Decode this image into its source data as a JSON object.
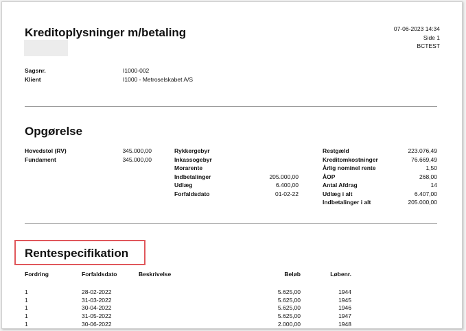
{
  "header": {
    "title": "Kreditoplysninger m/betaling",
    "date_time": "07-06-2023 14:34",
    "page": "Side 1",
    "company": "BCTEST"
  },
  "case": {
    "sagsnr_label": "Sagsnr.",
    "sagsnr_value": "I1000-002",
    "klient_label": "Klient",
    "klient_value": "I1000 - Metroselskabet A/S"
  },
  "opgorelse": {
    "heading": "Opgørelse",
    "col1": [
      {
        "label": "Hovedstol (RV)",
        "value": "345.000,00"
      },
      {
        "label": "Fundament",
        "value": "345.000,00"
      }
    ],
    "col2": [
      {
        "label": "Rykkergebyr",
        "value": ""
      },
      {
        "label": "Inkassogebyr",
        "value": ""
      },
      {
        "label": "Morarente",
        "value": ""
      },
      {
        "label": "Indbetalinger",
        "value": "205.000,00"
      },
      {
        "label": "Udlæg",
        "value": "6.400,00"
      },
      {
        "label": "Forfaldsdato",
        "value": "01-02-22"
      }
    ],
    "col3": [
      {
        "label": "Restgæld",
        "value": "223.076,49"
      },
      {
        "label": "Kreditomkostninger",
        "value": "76.669,49"
      },
      {
        "label": "Årlig nominel rente",
        "value": "1,50"
      },
      {
        "label": "ÅOP",
        "value": "268,00"
      },
      {
        "label": "Antal Afdrag",
        "value": "14"
      },
      {
        "label": "Udlæg i alt",
        "value": "6.407,00"
      },
      {
        "label": "Indbetalinger i alt",
        "value": "205.000,00"
      }
    ]
  },
  "rentespec": {
    "heading": "Rentespecifikation",
    "highlight_color": "#e0575b",
    "columns": {
      "fordring": "Fordring",
      "forfaldsdato": "Forfaldsdato",
      "beskrivelse": "Beskrivelse",
      "belob": "Beløb",
      "lobenr": "Løbenr."
    },
    "rows": [
      {
        "fordring": "1",
        "forfaldsdato": "28-02-2022",
        "beskrivelse": "",
        "belob": "5.625,00",
        "lobenr": "1944"
      },
      {
        "fordring": "1",
        "forfaldsdato": "31-03-2022",
        "beskrivelse": "",
        "belob": "5.625,00",
        "lobenr": "1945"
      },
      {
        "fordring": "1",
        "forfaldsdato": "30-04-2022",
        "beskrivelse": "",
        "belob": "5.625,00",
        "lobenr": "1946"
      },
      {
        "fordring": "1",
        "forfaldsdato": "31-05-2022",
        "beskrivelse": "",
        "belob": "5.625,00",
        "lobenr": "1947"
      },
      {
        "fordring": "1",
        "forfaldsdato": "30-06-2022",
        "beskrivelse": "",
        "belob": "2.000,00",
        "lobenr": "1948"
      }
    ]
  }
}
